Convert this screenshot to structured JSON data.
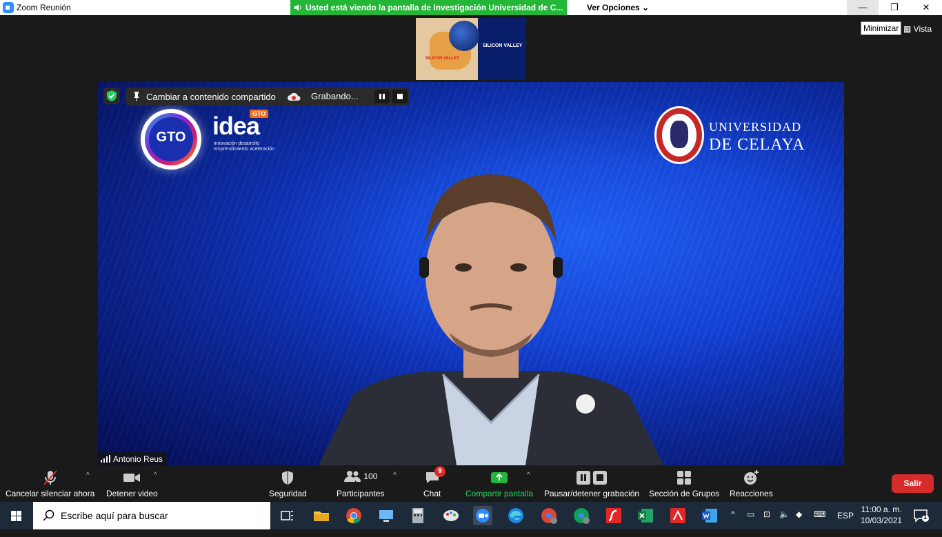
{
  "window": {
    "title": "Zoom Reunión",
    "share_banner": "Usted está viendo la pantalla de Investigación Universidad de C...",
    "view_options": "Ver Opciones",
    "minimize_tooltip": "Minimizar",
    "view_label": "Vista"
  },
  "thumbnail": {
    "title": "SILICON VALLEY",
    "map_label": "SILICON VALLEY"
  },
  "video": {
    "gto_logo_text": "GTO",
    "idea_word": "idea",
    "idea_tag": "GTO",
    "idea_sub": "innovación desarrollo emprendimiento aceleración",
    "university_line1": "UNIVERSIDAD",
    "university_line2": "DE CELAYA",
    "participant_name": "Antonio Reus",
    "switch_label": "Cambiar a contenido compartido",
    "recording_label": "Grabando..."
  },
  "toolbar": {
    "mute": "Cancelar silenciar ahora",
    "video": "Detener video",
    "security": "Seguridad",
    "participants": "Participantes",
    "participants_count": "100",
    "chat": "Chat",
    "chat_badge": "9",
    "share": "Compartir pantalla",
    "record": "Pausar/detener grabación",
    "breakout": "Sección de Grupos",
    "reactions": "Reacciones",
    "leave": "Salir"
  },
  "taskbar": {
    "search_placeholder": "Escribe aquí para buscar",
    "lang": "ESP",
    "time": "11:00 a. m.",
    "date": "10/03/2021",
    "notif_count": "1"
  },
  "colors": {
    "zoom_blue": "#2D8CFF",
    "banner_green": "#24b637",
    "leave_red": "#d52b2b",
    "video_blue": "#1038c8"
  }
}
